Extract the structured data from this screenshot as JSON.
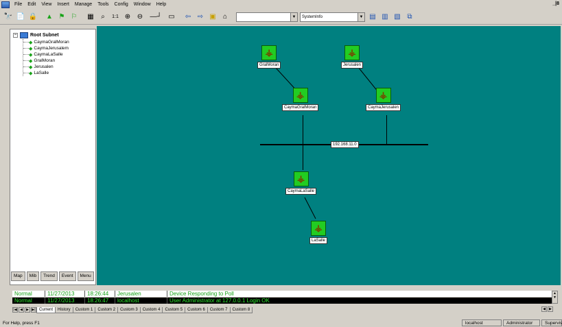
{
  "menubar": {
    "items": [
      "File",
      "Edit",
      "View",
      "Insert",
      "Manage",
      "Tools",
      "Config",
      "Window",
      "Help"
    ],
    "window_controls": "_|8"
  },
  "toolbar": {
    "zoom_label": "1:1",
    "combo_empty": "",
    "combo_view": "SystemInfo"
  },
  "tree": {
    "root": "Root Subnet",
    "items": [
      "CaymaGralMoran",
      "CaymaJerusalem",
      "CaymaLaSalle",
      "GralMoran",
      "Jerusalen",
      "LaSalle"
    ]
  },
  "left_tabs": [
    "Map",
    "Mib",
    "Trend",
    "Event",
    "Menu"
  ],
  "map": {
    "devices": [
      {
        "name": "GralMoran"
      },
      {
        "name": "Jerusalen"
      },
      {
        "name": "CaymaGralMoran"
      },
      {
        "name": "CaymaJerusalen"
      },
      {
        "name": "CaymaLaSalle"
      },
      {
        "name": "LaSalle"
      }
    ],
    "subnet": "192.168.11.0",
    "colors": {
      "background": "#008080",
      "device": "#22cc22"
    }
  },
  "events": {
    "rows": [
      {
        "status": "Normal",
        "date": "11/27/2013",
        "time": "18:26:44",
        "source": "Jerusalen",
        "message": "Device Responding to Poll"
      },
      {
        "status": "Normal",
        "date": "11/27/2013",
        "time": "18:26:47",
        "source": "localhost",
        "message": "User Administrator at 127.0.0.1 Login OK"
      }
    ],
    "tabs": [
      "Current",
      "History",
      "Custom 1",
      "Custom 2",
      "Custom 3",
      "Custom 4",
      "Custom 5",
      "Custom 6",
      "Custom 7",
      "Custom 8"
    ]
  },
  "status": {
    "help": "For Help, press F1",
    "host": "localhost",
    "user": "Administrator",
    "role": "Supervis"
  }
}
